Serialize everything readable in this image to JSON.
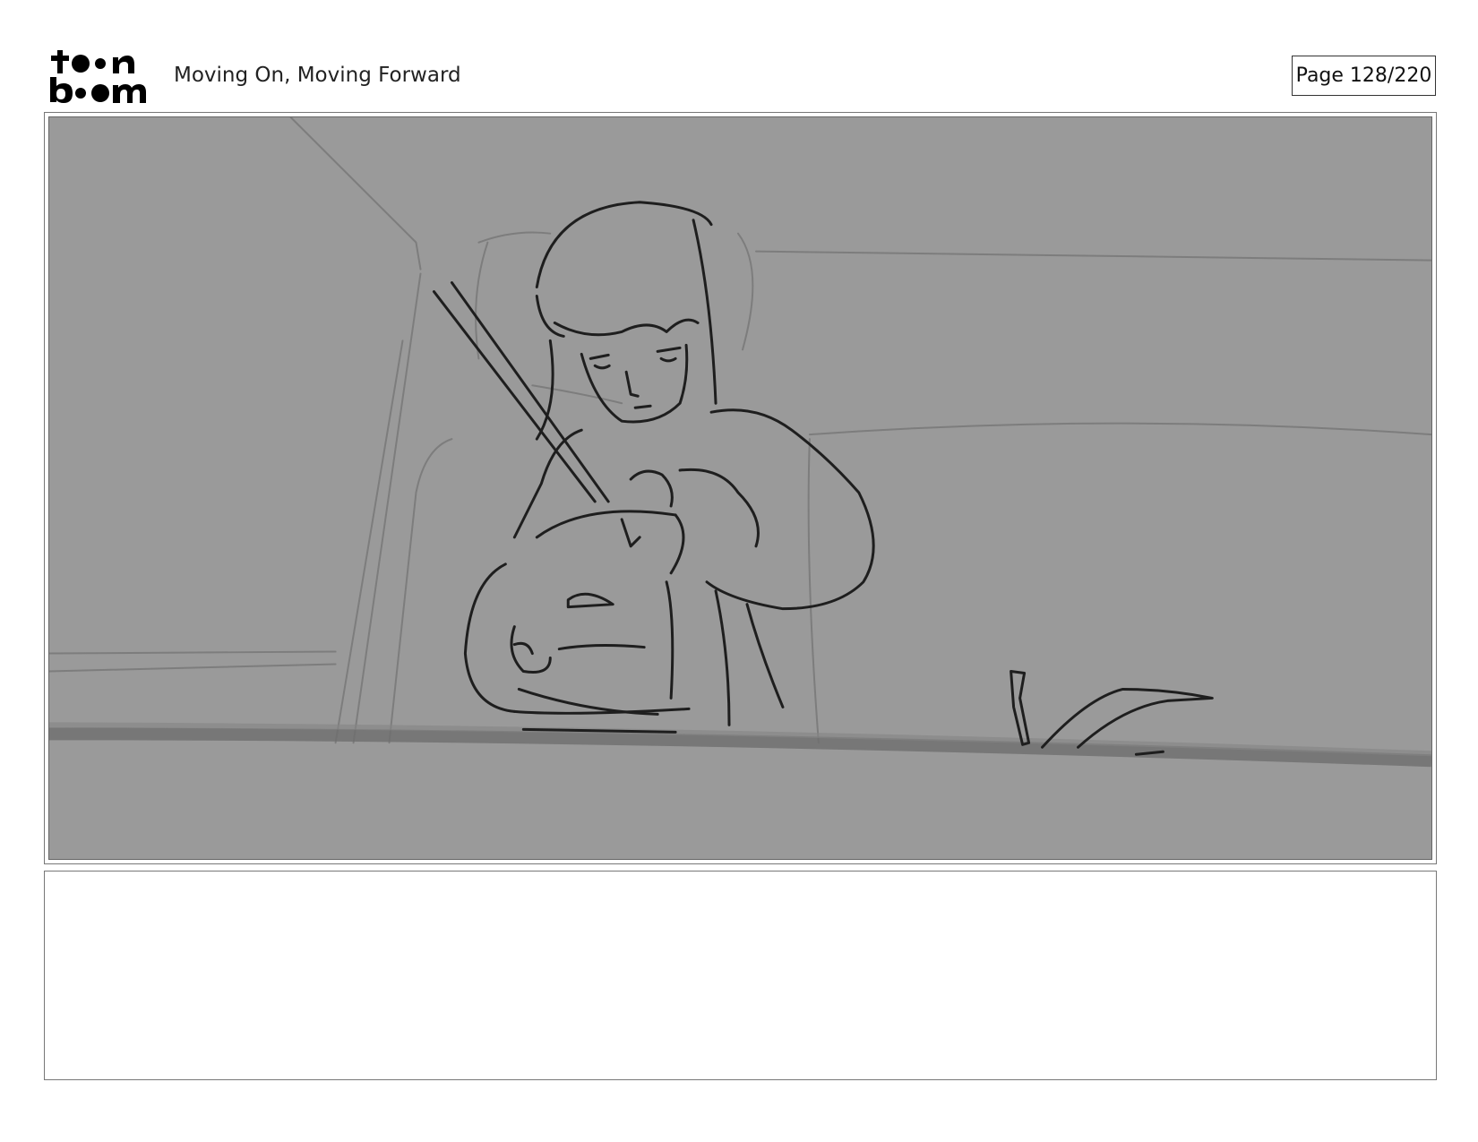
{
  "header": {
    "logo_text": "toon boom",
    "title": "Moving On, Moving Forward",
    "page_indicator": "Page 128/220"
  },
  "colors": {
    "panel_background": "#9a9a9a",
    "sketch_line": "#1e1e1e",
    "construction_line": "#7d7d7d"
  },
  "notes": {
    "text": ""
  }
}
